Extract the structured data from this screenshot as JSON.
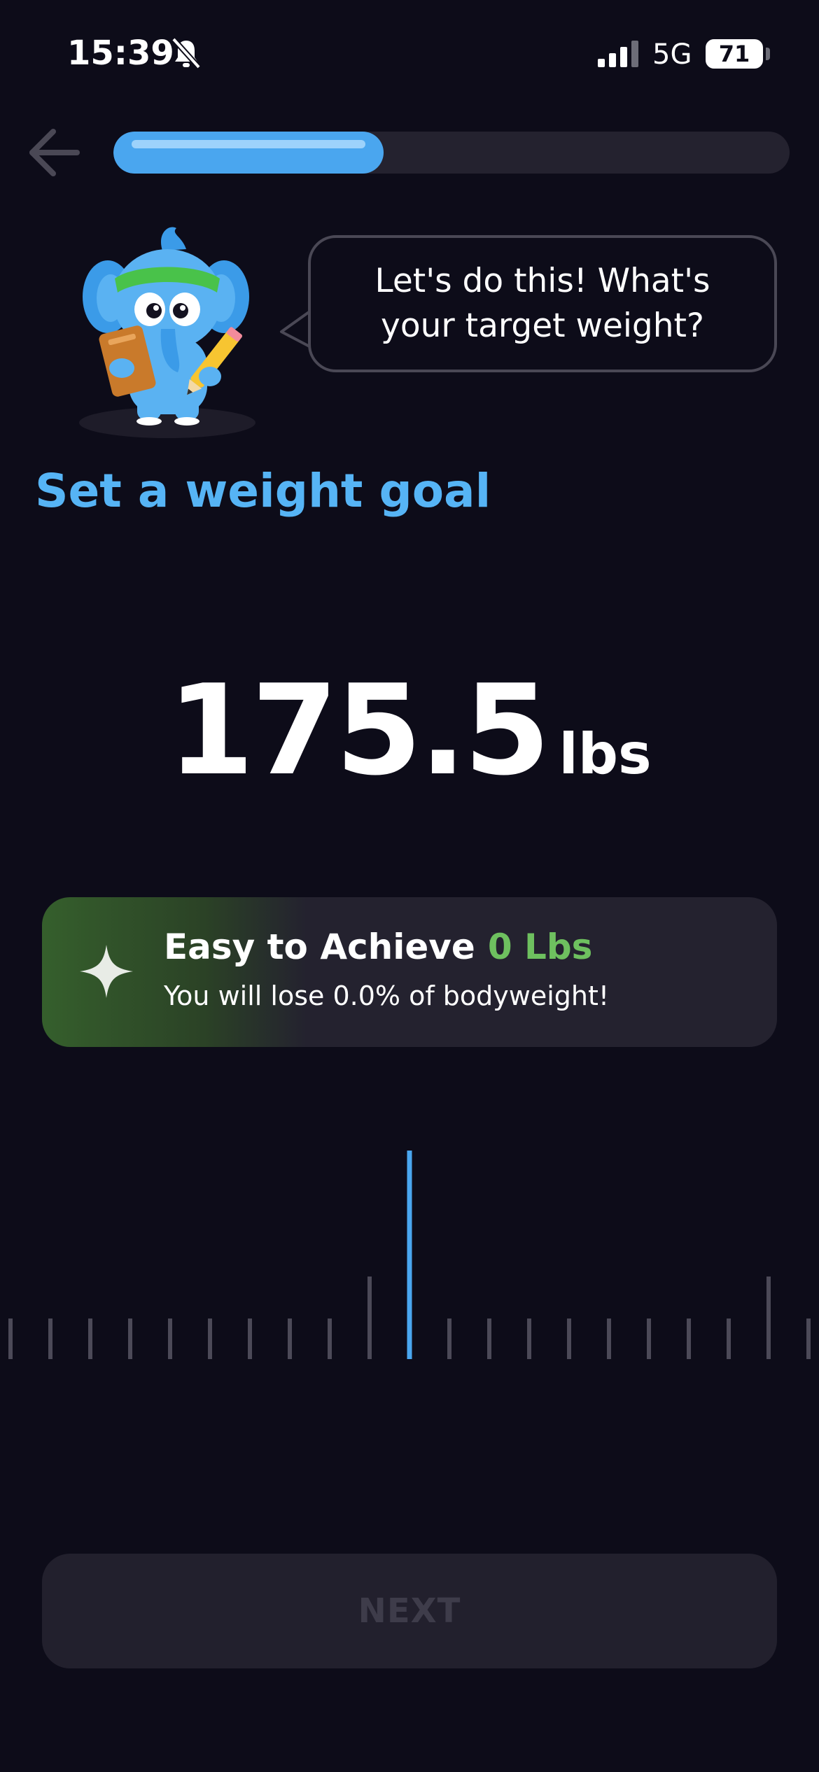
{
  "status_bar": {
    "time": "15:39",
    "network": "5G",
    "battery": "71",
    "icons": [
      "bell-slash-icon",
      "cellular-signal-icon",
      "battery-icon"
    ]
  },
  "nav": {
    "back_icon": "arrow-left-icon",
    "progress_fraction": 0.4
  },
  "speech_bubble": {
    "text_line1": "Let's do this! What's",
    "text_line2": "your target weight?"
  },
  "page_title": "Set a weight goal",
  "weight": {
    "value": "175.5",
    "unit": "lbs"
  },
  "goal_card": {
    "icon": "sparkle-icon",
    "label": "Easy to Achieve",
    "amount": "0 Lbs",
    "subtitle": "You will lose 0.0% of bodyweight!"
  },
  "ruler": {
    "selected_color": "#4aa6ef"
  },
  "next_button": {
    "label": "NEXT"
  },
  "colors": {
    "background": "#0d0c19",
    "accent_blue": "#56b4f5",
    "achieve_green": "#6ec05f",
    "card_bg": "#24222f"
  }
}
